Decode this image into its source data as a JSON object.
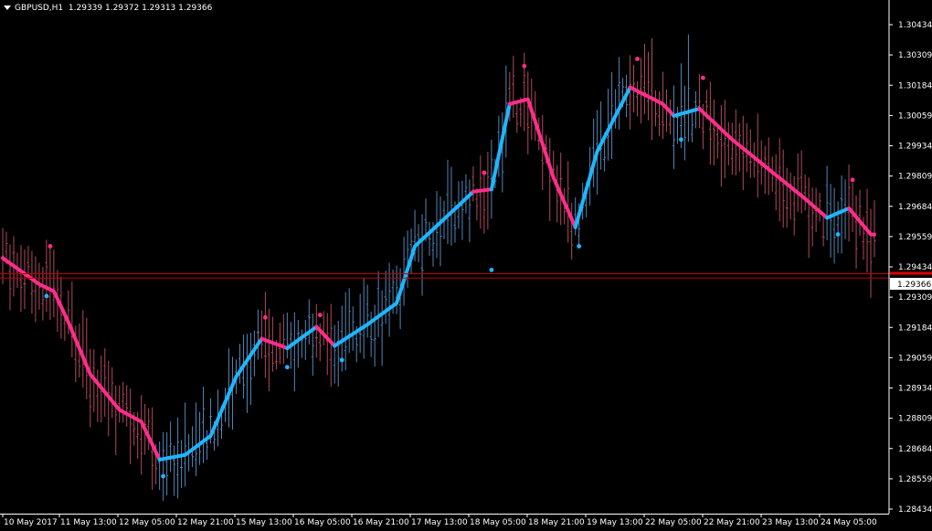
{
  "header": {
    "symbol": "GBPUSD,H1",
    "ohlc": "1.29339 1.29372 1.29313 1.29366"
  },
  "current_price": "1.29366",
  "colors": {
    "background": "#000000",
    "axis": "#ffffff",
    "bull": "#4f87b8",
    "bear": "#b04a5e",
    "trend_up": "#1fb6ff",
    "trend_down": "#ff2d8b",
    "bid_line": "#c00000",
    "ask_line": "#9aa7ff",
    "price_box": "#ffffff"
  },
  "chart_data": {
    "type": "line",
    "symbol": "GBPUSD",
    "timeframe": "H1",
    "ylim": [
      1.2838,
      1.305
    ],
    "y_ticks": [
      "1.30434",
      "1.30309",
      "1.30184",
      "1.30059",
      "1.29934",
      "1.29809",
      "1.29684",
      "1.29559",
      "1.29434",
      "1.29309",
      "1.29184",
      "1.29059",
      "1.28934",
      "1.28809",
      "1.28684",
      "1.28559",
      "1.28434"
    ],
    "x_ticks": [
      "10 May 2017",
      "11 May 13:00",
      "12 May 05:00",
      "12 May 21:00",
      "15 May 13:00",
      "16 May 05:00",
      "16 May 21:00",
      "17 May 13:00",
      "18 May 05:00",
      "18 May 21:00",
      "19 May 13:00",
      "22 May 05:00",
      "22 May 21:00",
      "23 May 13:00",
      "24 May 05:00"
    ],
    "bar_count": 240,
    "trend_line": [
      {
        "i": 0,
        "v": 1.2945,
        "c": "down"
      },
      {
        "i": 10,
        "v": 1.2934,
        "c": "down"
      },
      {
        "i": 14,
        "v": 1.2931,
        "c": "down"
      },
      {
        "i": 18,
        "v": 1.2918,
        "c": "down"
      },
      {
        "i": 24,
        "v": 1.2896,
        "c": "down"
      },
      {
        "i": 32,
        "v": 1.2881,
        "c": "down"
      },
      {
        "i": 38,
        "v": 1.2876,
        "c": "down"
      },
      {
        "i": 43,
        "v": 1.286,
        "c": "up"
      },
      {
        "i": 50,
        "v": 1.2862,
        "c": "up"
      },
      {
        "i": 57,
        "v": 1.287,
        "c": "up"
      },
      {
        "i": 64,
        "v": 1.2895,
        "c": "up"
      },
      {
        "i": 71,
        "v": 1.2911,
        "c": "down"
      },
      {
        "i": 78,
        "v": 1.2907,
        "c": "up"
      },
      {
        "i": 86,
        "v": 1.2916,
        "c": "down"
      },
      {
        "i": 91,
        "v": 1.2908,
        "c": "up"
      },
      {
        "i": 100,
        "v": 1.2917,
        "c": "up"
      },
      {
        "i": 108,
        "v": 1.2926,
        "c": "up"
      },
      {
        "i": 113,
        "v": 1.295,
        "c": "up"
      },
      {
        "i": 120,
        "v": 1.296,
        "c": "up"
      },
      {
        "i": 129,
        "v": 1.2973,
        "c": "down"
      },
      {
        "i": 134,
        "v": 1.2974,
        "c": "up"
      },
      {
        "i": 139,
        "v": 1.301,
        "c": "down"
      },
      {
        "i": 144,
        "v": 1.3012,
        "c": "down"
      },
      {
        "i": 151,
        "v": 1.2979,
        "c": "down"
      },
      {
        "i": 157,
        "v": 1.2958,
        "c": "up"
      },
      {
        "i": 163,
        "v": 1.299,
        "c": "up"
      },
      {
        "i": 172,
        "v": 1.3017,
        "c": "down"
      },
      {
        "i": 181,
        "v": 1.301,
        "c": "down"
      },
      {
        "i": 184,
        "v": 1.3005,
        "c": "up"
      },
      {
        "i": 191,
        "v": 1.3008,
        "c": "down"
      },
      {
        "i": 200,
        "v": 1.2995,
        "c": "down"
      },
      {
        "i": 212,
        "v": 1.298,
        "c": "down"
      },
      {
        "i": 220,
        "v": 1.297,
        "c": "down"
      },
      {
        "i": 226,
        "v": 1.2962,
        "c": "up"
      },
      {
        "i": 232,
        "v": 1.2966,
        "c": "down"
      },
      {
        "i": 238,
        "v": 1.2955,
        "c": "down"
      }
    ],
    "signal_dots": [
      {
        "i": 13,
        "v": 1.295,
        "c": "down"
      },
      {
        "i": 12,
        "v": 1.2929,
        "c": "up"
      },
      {
        "i": 44,
        "v": 1.2853,
        "c": "up"
      },
      {
        "i": 72,
        "v": 1.292,
        "c": "down"
      },
      {
        "i": 78,
        "v": 1.2899,
        "c": "up"
      },
      {
        "i": 87,
        "v": 1.2921,
        "c": "down"
      },
      {
        "i": 93,
        "v": 1.2902,
        "c": "up"
      },
      {
        "i": 132,
        "v": 1.2981,
        "c": "down"
      },
      {
        "i": 134,
        "v": 1.294,
        "c": "up"
      },
      {
        "i": 143,
        "v": 1.3026,
        "c": "down"
      },
      {
        "i": 158,
        "v": 1.295,
        "c": "up"
      },
      {
        "i": 174,
        "v": 1.3029,
        "c": "down"
      },
      {
        "i": 186,
        "v": 1.2995,
        "c": "up"
      },
      {
        "i": 192,
        "v": 1.3021,
        "c": "down"
      },
      {
        "i": 229,
        "v": 1.2955,
        "c": "up"
      },
      {
        "i": 233,
        "v": 1.2978,
        "c": "down"
      }
    ],
    "bid_price": 1.29366,
    "ask_price": 1.29384
  }
}
